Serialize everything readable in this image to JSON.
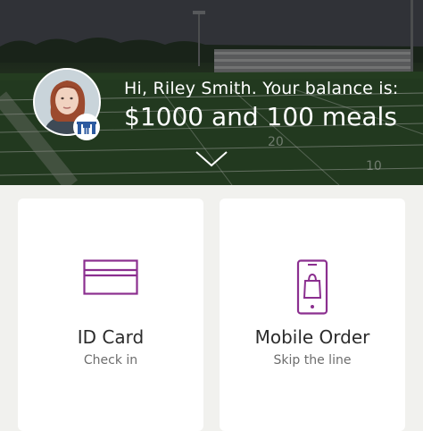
{
  "header": {
    "greeting": "Hi, Riley Smith. Your balance is:",
    "balance": "$1000 and 100 meals",
    "avatar_icon": "profile-photo",
    "badge_icon": "university-logo-icon",
    "expand_icon": "chevron-down-icon"
  },
  "cards": [
    {
      "title": "ID Card",
      "subtitle": "Check in",
      "icon": "id-card-icon"
    },
    {
      "title": "Mobile Order",
      "subtitle": "Skip the line",
      "icon": "mobile-order-icon"
    }
  ],
  "colors": {
    "accent": "#8b2f8f",
    "text_primary": "#2b2b2b",
    "text_secondary": "#6d6d6d",
    "background": "#f1f1ee",
    "card": "#ffffff"
  }
}
